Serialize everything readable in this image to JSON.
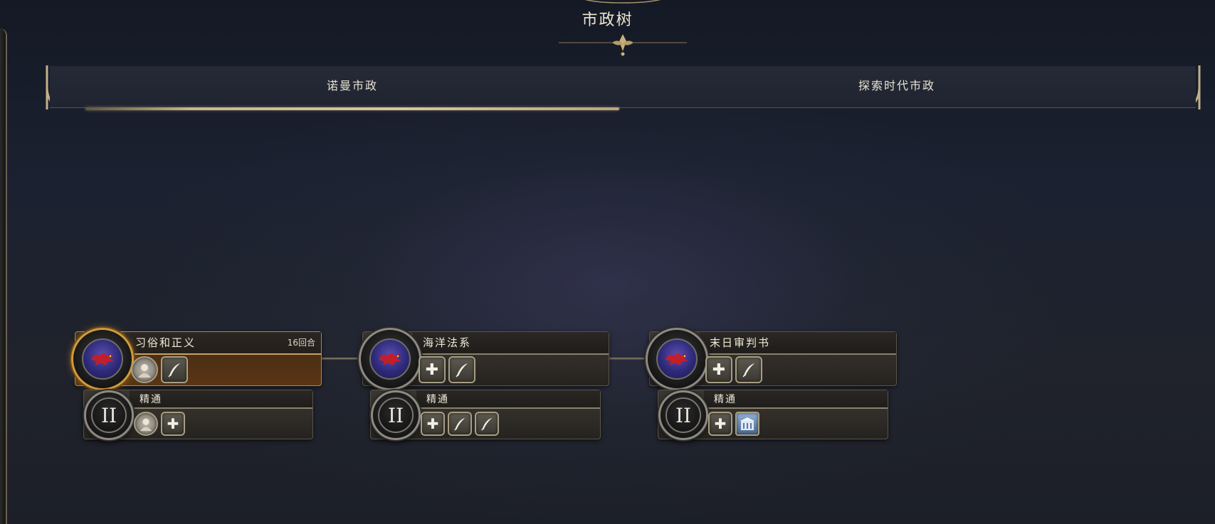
{
  "screen": {
    "title": "市政树"
  },
  "tabs": [
    {
      "label": "诺曼市政",
      "active": true
    },
    {
      "label": "探索时代市政",
      "active": false
    }
  ],
  "civics": [
    {
      "name": "习俗和正义",
      "turns": "16回合",
      "active": true,
      "icons": [
        "unit-portrait-icon",
        "quill-icon"
      ],
      "mastery": {
        "label": "精通",
        "numeral": "II",
        "icons": [
          "unit-portrait-icon",
          "plus-icon"
        ]
      }
    },
    {
      "name": "海洋法系",
      "turns": "",
      "active": false,
      "icons": [
        "plus-icon",
        "quill-icon"
      ],
      "mastery": {
        "label": "精通",
        "numeral": "II",
        "icons": [
          "plus-icon",
          "quill-icon",
          "quill-icon"
        ]
      }
    },
    {
      "name": "末日审判书",
      "turns": "",
      "active": false,
      "icons": [
        "plus-icon",
        "quill-icon"
      ],
      "mastery": {
        "label": "精通",
        "numeral": "II",
        "icons": [
          "plus-icon",
          "building-icon"
        ]
      }
    }
  ],
  "colors": {
    "accent_gold": "#c9b88a",
    "active_orange": "#d29a3c",
    "emblem_blue": "#2e2a7a",
    "emblem_red": "#c21f2a"
  }
}
